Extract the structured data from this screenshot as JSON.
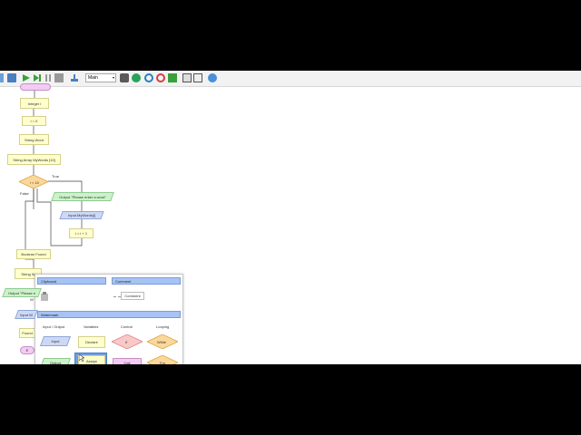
{
  "toolbar": {
    "program_select": "Main"
  },
  "flowchart": {
    "start_label": "",
    "declare_integer": "Integer i",
    "assign_i": "i = 0",
    "declare_string": "String Word",
    "declare_array": "String Array MyWords [10]",
    "decision": "i < 10",
    "decision_true": "True",
    "decision_false": "False",
    "output_prompt": "Output \"Please enter a word\"",
    "input_array": "Input MyWords[i]",
    "increment": "i = i + 1",
    "boolean_partial": "Boolean Found",
    "string_partial": "String W",
    "output_partial": "Output \"Please e",
    "output_partial_2": "W",
    "input_partial": "Input W",
    "found_partial": "Found",
    "end_partial": "E"
  },
  "palette": {
    "clipboard_header": "Clipboard",
    "comment_header": "Comment",
    "comment_item": "Comment",
    "watermark_header": "Watermark",
    "columns": [
      "Input / Output",
      "Variables",
      "Control",
      "Looping"
    ],
    "input_shape": "Input",
    "output_shape": "Output",
    "declare_shape": "Declare",
    "assign_shape": "Assign",
    "if_shape": "If",
    "call_shape": "Call",
    "while_shape": "While",
    "for_shape": "For"
  },
  "colors": {
    "rect_fill": "#ffffcc",
    "io_fill": "#ccf2cc",
    "input_fill": "#cdd8f5",
    "decision_fill": "#fbd89a",
    "call_fill": "#f3ccf3",
    "control_fill": "#f9c8c8",
    "header_fill": "#a6c3f5"
  }
}
